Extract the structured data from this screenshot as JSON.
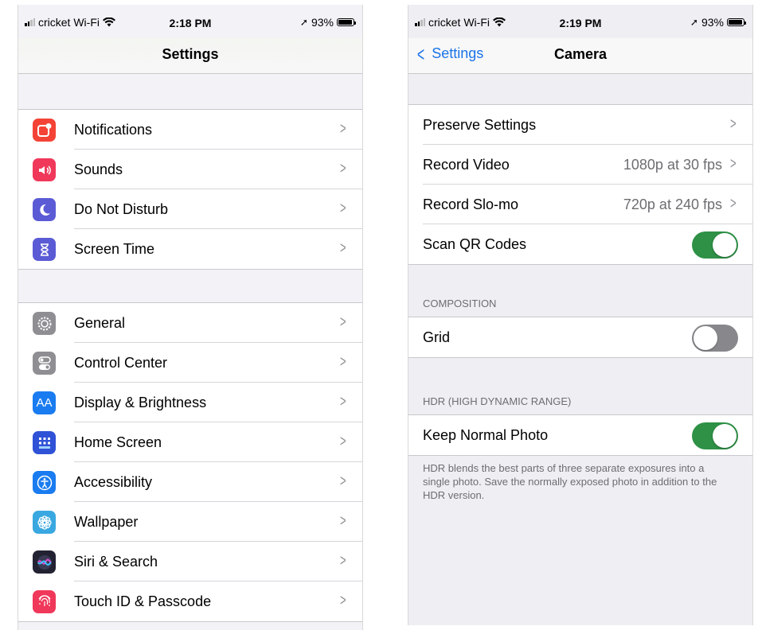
{
  "left_screen": {
    "status": {
      "carrier": "cricket Wi-Fi",
      "time": "2:18 PM",
      "battery": "93%"
    },
    "title": "Settings",
    "group1": [
      {
        "label": "Notifications",
        "icon": "notifications-icon",
        "color": "#f44336"
      },
      {
        "label": "Sounds",
        "icon": "sounds-icon",
        "color": "#f0385a"
      },
      {
        "label": "Do Not Disturb",
        "icon": "moon-icon",
        "color": "#5b5bd6"
      },
      {
        "label": "Screen Time",
        "icon": "hourglass-icon",
        "color": "#5b5bd6"
      }
    ],
    "group2": [
      {
        "label": "General",
        "icon": "gear-icon",
        "color": "#8e8e93"
      },
      {
        "label": "Control Center",
        "icon": "toggles-icon",
        "color": "#8e8e93"
      },
      {
        "label": "Display & Brightness",
        "icon": "text-size-icon",
        "color": "#1a7cf0",
        "glyph": "AA"
      },
      {
        "label": "Home Screen",
        "icon": "home-grid-icon",
        "color": "#2f52d6"
      },
      {
        "label": "Accessibility",
        "icon": "accessibility-icon",
        "color": "#1a7cf0"
      },
      {
        "label": "Wallpaper",
        "icon": "flower-icon",
        "color": "#3aa8e0"
      },
      {
        "label": "Siri & Search",
        "icon": "siri-icon",
        "color": "#222233"
      },
      {
        "label": "Touch ID & Passcode",
        "icon": "fingerprint-icon",
        "color": "#f0385a"
      }
    ]
  },
  "right_screen": {
    "status": {
      "carrier": "cricket Wi-Fi",
      "time": "2:19 PM",
      "battery": "93%"
    },
    "back_label": "Settings",
    "title": "Camera",
    "rows": [
      {
        "label": "Preserve Settings"
      },
      {
        "label": "Record Video",
        "value": "1080p at 30 fps"
      },
      {
        "label": "Record Slo-mo",
        "value": "720p at 240 fps"
      },
      {
        "label": "Scan QR Codes",
        "toggle": true
      }
    ],
    "composition_header": "COMPOSITION",
    "grid": {
      "label": "Grid",
      "toggle": false
    },
    "hdr_header": "HDR (HIGH DYNAMIC RANGE)",
    "keep_normal": {
      "label": "Keep Normal Photo",
      "toggle": true
    },
    "hdr_note": "HDR blends the best parts of three separate exposures into a single photo. Save the normally exposed photo in addition to the HDR version."
  },
  "glyphs": {
    "chevron": ">",
    "back_chevron": "<"
  }
}
